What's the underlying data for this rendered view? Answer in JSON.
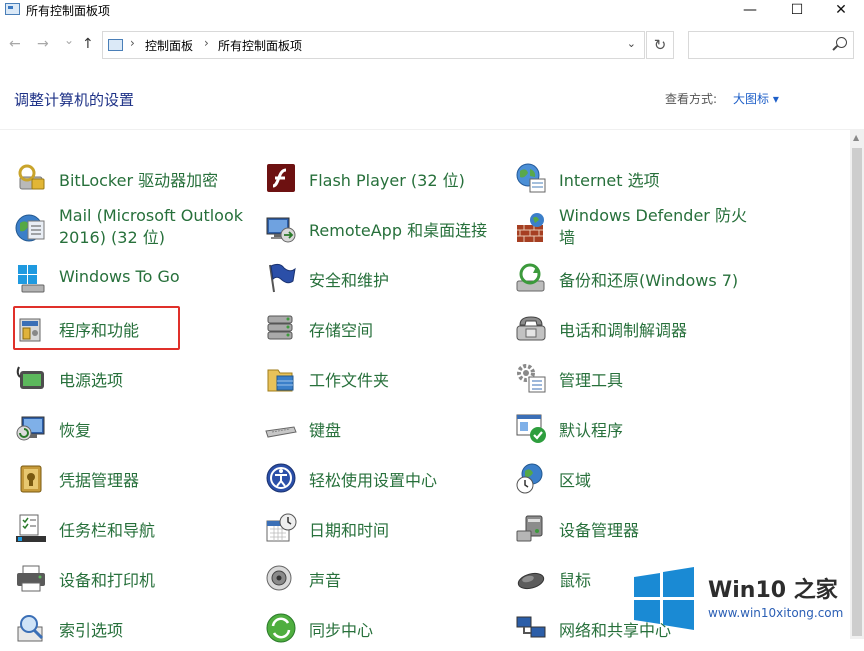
{
  "window": {
    "title": "所有控制面板项",
    "minimize": "—",
    "maximize": "☐",
    "close": "✕"
  },
  "nav": {
    "back": "←",
    "forward": "→",
    "recent": "⌄",
    "up": "↑",
    "breadcrumb": [
      "控制面板",
      "所有控制面板项"
    ],
    "separator": "›",
    "dropdown": "⌄",
    "refresh": "↻",
    "search_placeholder": ""
  },
  "page": {
    "heading": "调整计算机的设置",
    "view_by_label": "查看方式:",
    "view_mode": "大图标 ▾"
  },
  "items": [
    {
      "label": "BitLocker 驱动器加密",
      "icon": "bitlocker-icon"
    },
    {
      "label": "Flash Player (32 位)",
      "icon": "flash-player-icon"
    },
    {
      "label": "Internet 选项",
      "icon": "internet-options-icon"
    },
    {
      "label": "Mail (Microsoft Outlook 2016) (32 位)",
      "icon": "mail-icon"
    },
    {
      "label": "RemoteApp 和桌面连接",
      "icon": "remoteapp-icon"
    },
    {
      "label": "Windows Defender 防火墙",
      "icon": "firewall-icon"
    },
    {
      "label": "Windows To Go",
      "icon": "windows-to-go-icon"
    },
    {
      "label": "安全和维护",
      "icon": "security-flag-icon"
    },
    {
      "label": "备份和还原(Windows 7)",
      "icon": "backup-icon"
    },
    {
      "label": "程序和功能",
      "icon": "programs-icon"
    },
    {
      "label": "存储空间",
      "icon": "storage-icon"
    },
    {
      "label": "电话和调制解调器",
      "icon": "phone-modem-icon"
    },
    {
      "label": "电源选项",
      "icon": "power-icon"
    },
    {
      "label": "工作文件夹",
      "icon": "work-folders-icon"
    },
    {
      "label": "管理工具",
      "icon": "admin-tools-icon"
    },
    {
      "label": "恢复",
      "icon": "recovery-icon"
    },
    {
      "label": "键盘",
      "icon": "keyboard-icon"
    },
    {
      "label": "默认程序",
      "icon": "default-programs-icon"
    },
    {
      "label": "凭据管理器",
      "icon": "credential-icon"
    },
    {
      "label": "轻松使用设置中心",
      "icon": "ease-of-access-icon"
    },
    {
      "label": "区域",
      "icon": "region-icon"
    },
    {
      "label": "任务栏和导航",
      "icon": "taskbar-icon"
    },
    {
      "label": "日期和时间",
      "icon": "date-time-icon"
    },
    {
      "label": "设备管理器",
      "icon": "device-manager-icon"
    },
    {
      "label": "设备和打印机",
      "icon": "printer-icon"
    },
    {
      "label": "声音",
      "icon": "sound-icon"
    },
    {
      "label": "鼠标",
      "icon": "mouse-icon"
    },
    {
      "label": "索引选项",
      "icon": "indexing-icon"
    },
    {
      "label": "同步中心",
      "icon": "sync-icon"
    },
    {
      "label": "网络和共享中心",
      "icon": "network-icon"
    }
  ],
  "highlight_item": "程序和功能",
  "watermark": {
    "title": "Win10 之家",
    "url": "www.win10xitong.com"
  },
  "colors": {
    "link_green": "#27703b",
    "heading_blue": "#1e3287",
    "highlight_red": "#e0302a",
    "watermark_blue": "#1a8ad4"
  }
}
